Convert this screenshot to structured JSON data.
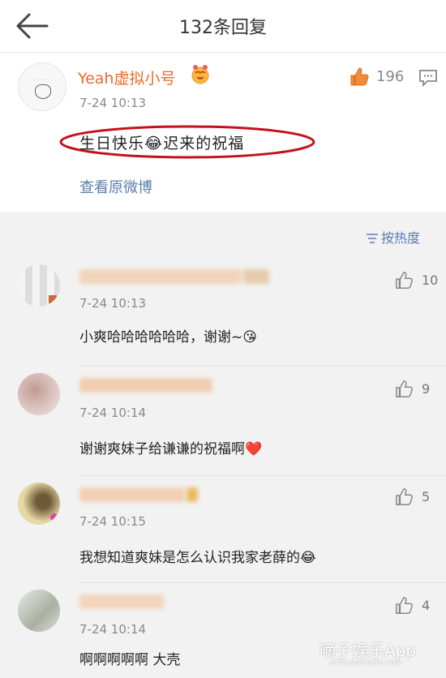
{
  "header": {
    "title": "132条回复"
  },
  "main_comment": {
    "username": "Yeah虚拟小号",
    "time": "7-24 10:13",
    "text": "生日快乐😂迟来的祝福",
    "view_original": "查看原微博",
    "likes": "196"
  },
  "sort": {
    "label": "按热度"
  },
  "replies": [
    {
      "time": "7-24 10:13",
      "text": "小爽哈哈哈哈哈哈，谢谢~😘",
      "likes": "10"
    },
    {
      "time": "7-24 10:14",
      "text": "谢谢爽妹子给谦谦的祝福啊❤️",
      "likes": "9"
    },
    {
      "time": "7-24 10:15",
      "text": "我想知道爽妹是怎么认识我家老薛的😂",
      "likes": "5"
    },
    {
      "time": "7-24 10:14",
      "text": "啊啊啊啊啊 大壳",
      "likes": "4"
    }
  ],
  "watermark": {
    "text": "嘀子娱乐App",
    "sub": "HTTP://APP.HUPU.COM"
  },
  "colors": {
    "accent_orange": "#e86b2a",
    "link_blue": "#5a7eae",
    "ellipse_red": "#c3121b"
  }
}
